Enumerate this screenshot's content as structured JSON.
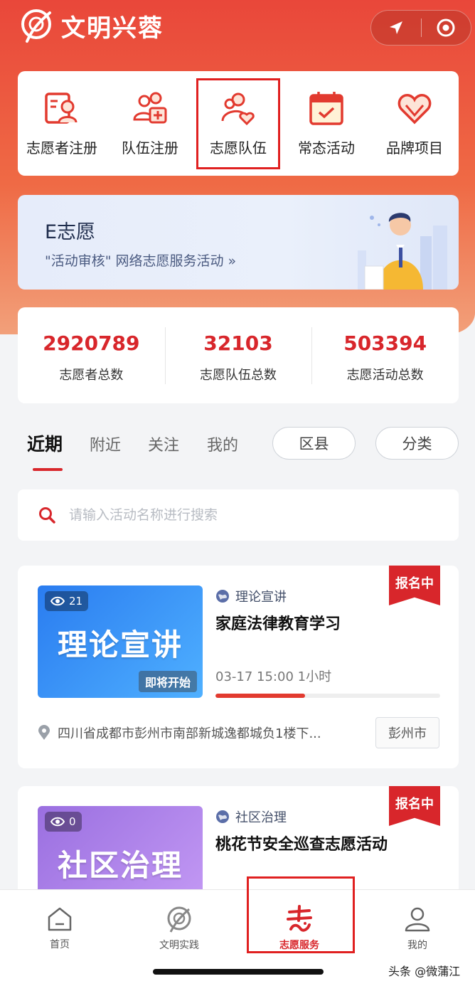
{
  "app": {
    "title": "文明兴蓉"
  },
  "quick_menu": [
    {
      "label": "志愿者注册",
      "icon": "volunteer-register-icon"
    },
    {
      "label": "队伍注册",
      "icon": "team-register-icon"
    },
    {
      "label": "志愿队伍",
      "icon": "volunteer-team-icon"
    },
    {
      "label": "常态活动",
      "icon": "calendar-check-icon"
    },
    {
      "label": "品牌项目",
      "icon": "heart-brand-icon"
    }
  ],
  "banner": {
    "title": "E志愿",
    "subtitle": "\"活动审核\" 网络志愿服务活动 »"
  },
  "stats": [
    {
      "value": "2920789",
      "label": "志愿者总数"
    },
    {
      "value": "32103",
      "label": "志愿队伍总数"
    },
    {
      "value": "503394",
      "label": "志愿活动总数"
    }
  ],
  "tabs": [
    "近期",
    "附近",
    "关注",
    "我的"
  ],
  "filters": {
    "district": "区县",
    "category": "分类"
  },
  "search": {
    "placeholder": "请输入活动名称进行搜索"
  },
  "activities": [
    {
      "thumb_text": "理论宣讲",
      "views": "21",
      "soon": "即将开始",
      "status": "报名中",
      "category": "理论宣讲",
      "title": "家庭法律教育学习",
      "time": "03-17 15:00  1小时",
      "progress": 0.4,
      "location": "四川省成都市彭州市南部新城逸都城负1楼下...",
      "district": "彭州市",
      "colors": [
        "#2a7cf0",
        "#4fb0ff"
      ]
    },
    {
      "thumb_text": "社区治理",
      "views": "0",
      "status": "报名中",
      "category": "社区治理",
      "title": "桃花节安全巡查志愿活动",
      "colors": [
        "#9a6fe0",
        "#c59bf5"
      ]
    }
  ],
  "tabbar": [
    {
      "label": "首页",
      "icon": "home-icon"
    },
    {
      "label": "文明实践",
      "icon": "civilization-icon"
    },
    {
      "label": "志愿服务",
      "icon": "volunteer-service-icon"
    },
    {
      "label": "我的",
      "icon": "user-icon"
    }
  ],
  "watermark": "头条 @微蒲江",
  "colors": {
    "primary": "#d8262b",
    "accent": "#e9473a"
  }
}
